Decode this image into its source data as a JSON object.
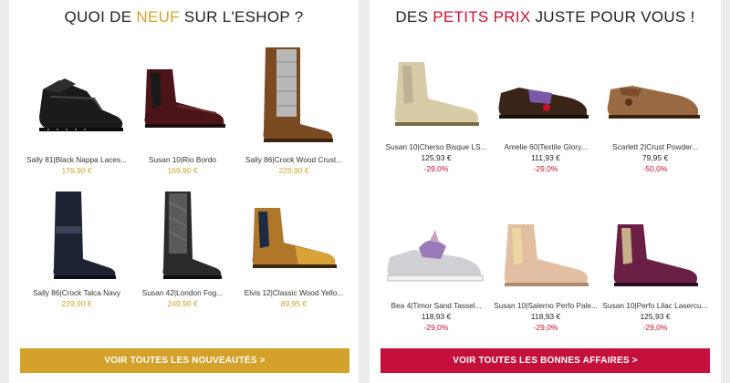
{
  "new_section": {
    "title_before": "QUOI DE ",
    "title_highlight": "NEUF",
    "title_after": " SUR L'ESHOP ?",
    "products": [
      {
        "name": "Sally 81|Black Nappa Laces...",
        "price": "179,90 €",
        "icon": "black-lace-up-boot-icon"
      },
      {
        "name": "Susan 10|Rio Bordo",
        "price": "169,90 €",
        "icon": "bordeaux-chelsea-boot-icon"
      },
      {
        "name": "Sally 86|Crock Wood Crust...",
        "price": "229,90 €",
        "icon": "tall-brown-silver-boot-icon"
      },
      {
        "name": "Sally 86|Crock Talca Navy",
        "price": "229,90 €",
        "icon": "tall-navy-boot-icon"
      },
      {
        "name": "Susan 42|London Fog...",
        "price": "249,90 €",
        "icon": "tall-grey-black-boot-icon"
      },
      {
        "name": "Elvis 12|Classic Wood Yello...",
        "price": "89,95 €",
        "icon": "yellow-wood-chelsea-boot-icon"
      }
    ],
    "cta_label": "VOIR TOUTES LES NOUVEAUTÉS >"
  },
  "deals_section": {
    "title_before": "DES ",
    "title_highlight": "PETITS PRIX",
    "title_after": " JUSTE POUR VOUS !",
    "products": [
      {
        "name": "Susan 10|Cherso Bisque LS...",
        "price": "125,93 €",
        "discount": "-29,0%",
        "icon": "gold-chelsea-boot-icon"
      },
      {
        "name": "Amelie 60|Textile Glory...",
        "price": "111,93 €",
        "discount": "-29,0%",
        "icon": "tassel-loafer-icon"
      },
      {
        "name": "Scarlett 2|Crust Powder...",
        "price": "79,95 €",
        "discount": "-50,0%",
        "icon": "brown-tassel-mule-icon"
      },
      {
        "name": "Bea 4|Timor Sand Tassel...",
        "price": "118,93 €",
        "discount": "-29,0%",
        "icon": "silver-tassel-sneaker-icon"
      },
      {
        "name": "Susan 10|Salerno Perfo Pale...",
        "price": "118,93 €",
        "discount": "-29,0%",
        "icon": "nude-chelsea-boot-icon"
      },
      {
        "name": "Susan 10|Perfo Lilac Lasercu...",
        "price": "125,93 €",
        "discount": "-29,0%",
        "icon": "purple-chelsea-boot-icon"
      }
    ],
    "cta_label": "VOIR TOUTES LES BONNES AFFAIRES >"
  },
  "colors": {
    "gold": "#d4a12a",
    "red": "#c4103a",
    "background": "#ececec"
  }
}
